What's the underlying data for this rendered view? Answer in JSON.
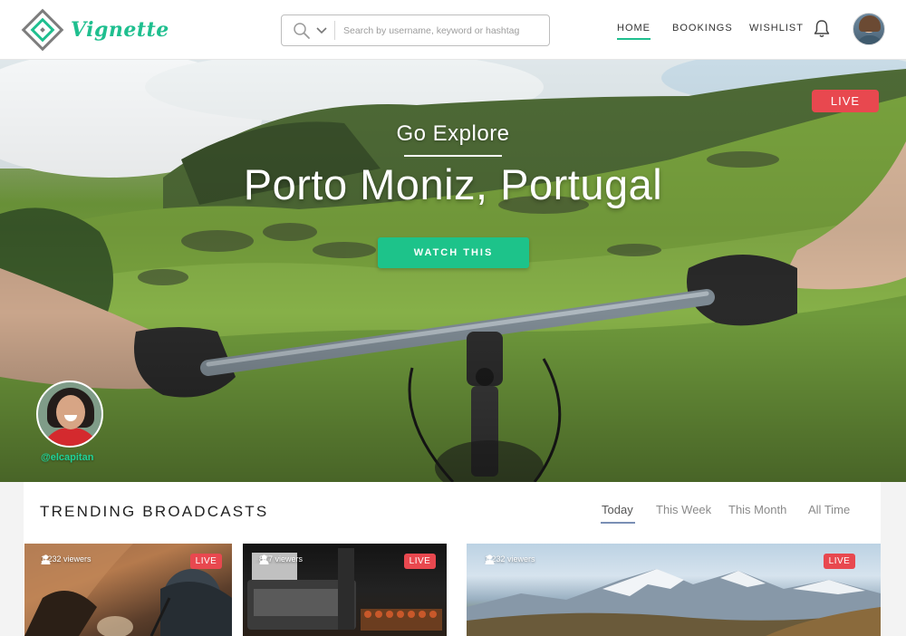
{
  "brand": {
    "name": "Vignette",
    "accent": "#1fbf8f"
  },
  "search": {
    "placeholder": "Search by username, keyword or hashtag"
  },
  "nav": {
    "home": "HOME",
    "bookings": "BOOKINGS",
    "wishlist": "WISHLIST",
    "active": "HOME"
  },
  "icons": [
    "search-icon",
    "chevron-down-icon",
    "bell-icon",
    "person-icon"
  ],
  "hero": {
    "eyebrow": "Go Explore",
    "title": "Porto Moniz, Portugal",
    "cta": "WATCH THIS",
    "live_label": "LIVE",
    "broadcaster_handle": "@elcapitan",
    "live_color": "#e8484f",
    "cta_color": "#1dc38a"
  },
  "trending": {
    "title": "TRENDING BROADCASTS",
    "tabs": [
      "Today",
      "This Week",
      "This Month",
      "All Time"
    ],
    "active_tab": "Today",
    "cards": [
      {
        "viewers": "1,232 viewers",
        "live_label": "LIVE"
      },
      {
        "viewers": "877 viewers",
        "live_label": "LIVE"
      },
      {
        "viewers": "1,232 viewers",
        "live_label": "LIVE"
      }
    ]
  }
}
